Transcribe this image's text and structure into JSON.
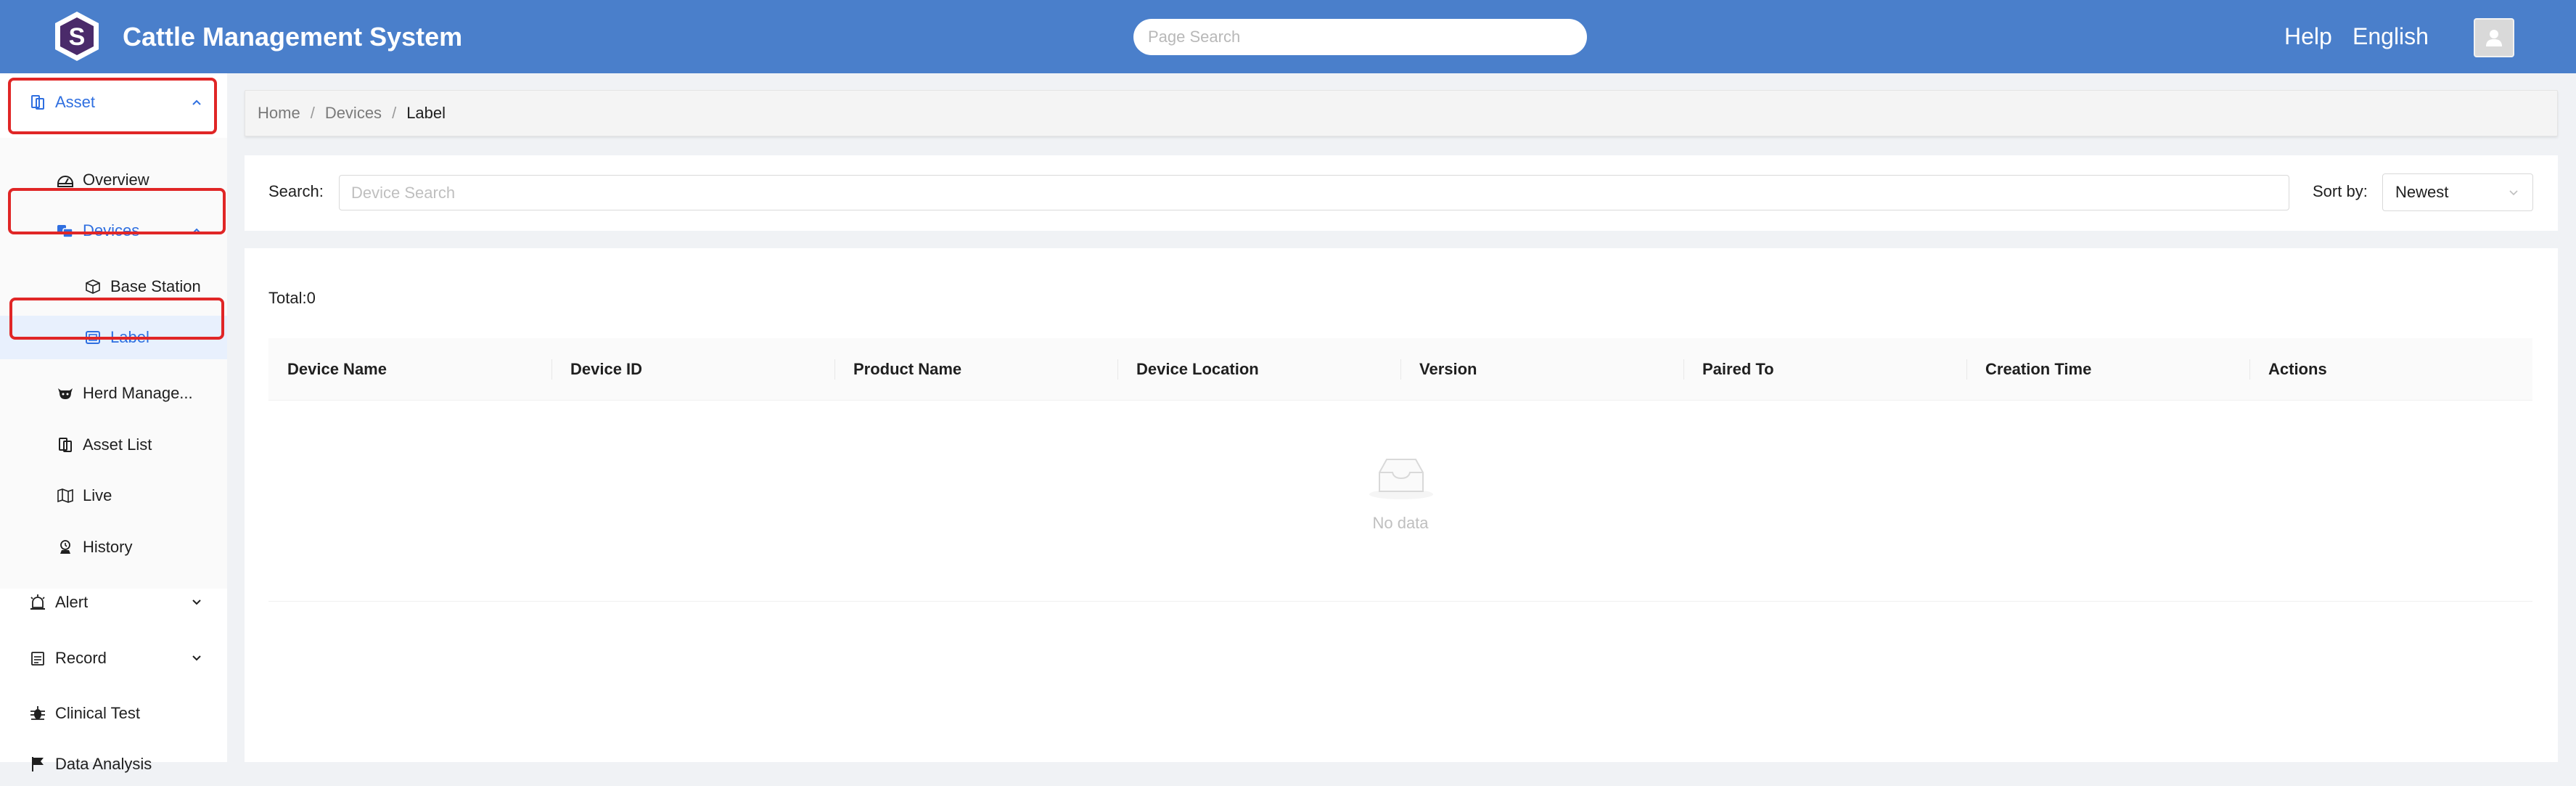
{
  "header": {
    "app_title": "Cattle Management System",
    "search_placeholder": "Page Search",
    "help_label": "Help",
    "language_label": "English",
    "brand_color": "#4a7fcb"
  },
  "sidebar": {
    "asset": {
      "label": "Asset",
      "icon": "asset-icon"
    },
    "overview": {
      "label": "Overview",
      "icon": "dashboard-icon"
    },
    "devices": {
      "label": "Devices",
      "icon": "devices-icon"
    },
    "base_station": {
      "label": "Base Station",
      "icon": "cube-icon"
    },
    "label_item": {
      "label": "Label",
      "icon": "tag-icon"
    },
    "herd_management": {
      "label": "Herd Manage...",
      "icon": "cow-icon"
    },
    "asset_list": {
      "label": "Asset List",
      "icon": "list-icon"
    },
    "live": {
      "label": "Live",
      "icon": "map-icon"
    },
    "history": {
      "label": "History",
      "icon": "history-icon"
    },
    "alert": {
      "label": "Alert",
      "icon": "alarm-icon"
    },
    "record": {
      "label": "Record",
      "icon": "calendar-icon"
    },
    "clinical_test": {
      "label": "Clinical Test",
      "icon": "bug-icon"
    },
    "data_analysis": {
      "label": "Data Analysis",
      "icon": "flag-icon"
    }
  },
  "breadcrumb": {
    "items": [
      "Home",
      "Devices",
      "Label"
    ],
    "separator": "/"
  },
  "filters": {
    "search_label": "Search:",
    "search_placeholder": "Device Search",
    "sort_label": "Sort by:",
    "sort_value": "Newest"
  },
  "table": {
    "total": "Total:0",
    "columns": [
      "Device Name",
      "Device ID",
      "Product Name",
      "Device Location",
      "Version",
      "Paired To",
      "Creation Time",
      "Actions"
    ],
    "empty_text": "No data"
  },
  "colors": {
    "accent": "#2f6fe0",
    "highlight": "#e02626"
  }
}
